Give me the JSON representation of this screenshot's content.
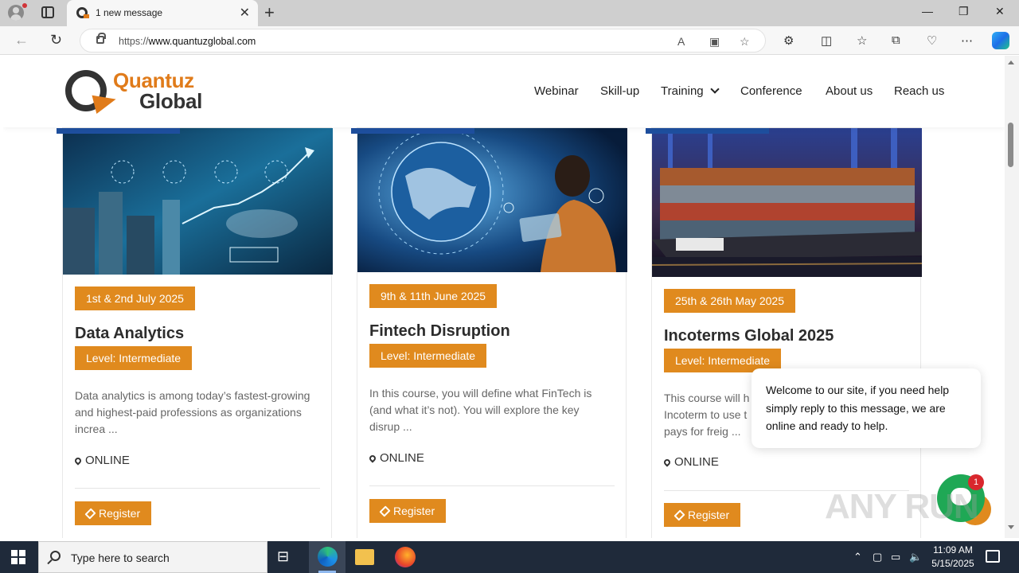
{
  "browser": {
    "tab_title": "1 new message",
    "url_prefix": "https://",
    "url_domain": "www.quantuzglobal.com"
  },
  "site": {
    "logo_line1": "Quantuz",
    "logo_line2": "Global",
    "nav": [
      "Webinar",
      "Skill-up",
      "Training",
      "Conference",
      "About us",
      "Reach us"
    ]
  },
  "courses": [
    {
      "date": "1st & 2nd July 2025",
      "title": "Data Analytics",
      "level": "Level: Intermediate",
      "description": "Data analytics is among today’s fastest-growing and highest-paid professions as organizations increa ...",
      "location": "ONLINE",
      "button": "Register"
    },
    {
      "date": "9th & 11th June 2025",
      "title": "Fintech Disruption",
      "level": "Level: Intermediate",
      "description": "In this course, you will define what FinTech is (and what it’s not). You will explore the key disrup ...",
      "location": "ONLINE",
      "button": "Register"
    },
    {
      "date": "25th & 26th May 2025",
      "title": "Incoterms Global 2025",
      "level": "Level: Intermediate",
      "description": "This course will h Incoterm to use t pays for freig ...",
      "location": "ONLINE",
      "button": "Register"
    }
  ],
  "chat": {
    "message": "Welcome to our site, if you need help simply reply to this message, we are online and ready to help.",
    "badge": "1"
  },
  "watermark": "ANY RUN",
  "taskbar": {
    "search_placeholder": "Type here to search",
    "time": "11:09 AM",
    "date": "5/15/2025"
  },
  "colors": {
    "accent": "#e08a1e",
    "brand_dark": "#333333",
    "band_blue": "#1e4f9e",
    "chat_green": "#1fa855"
  }
}
